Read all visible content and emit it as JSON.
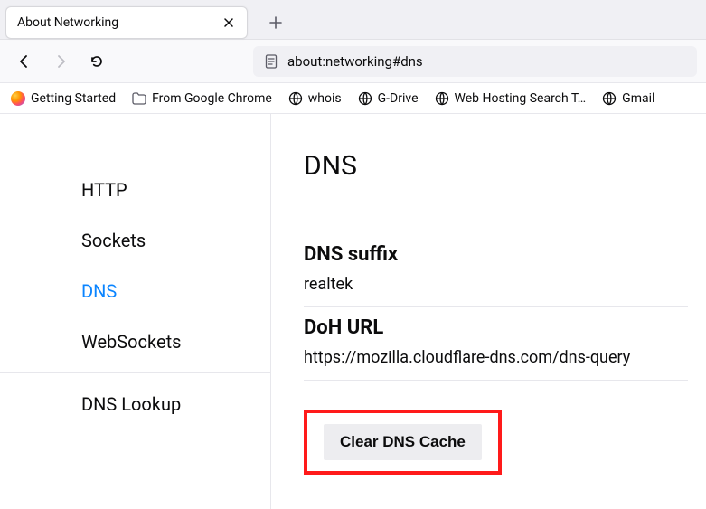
{
  "tab": {
    "title": "About Networking"
  },
  "urlbar": {
    "url": "about:networking#dns"
  },
  "bookmarks": [
    {
      "label": "Getting Started",
      "icon": "firefox"
    },
    {
      "label": "From Google Chrome",
      "icon": "folder"
    },
    {
      "label": "whois",
      "icon": "globe"
    },
    {
      "label": "G-Drive",
      "icon": "globe"
    },
    {
      "label": "Web Hosting Search T…",
      "icon": "globe"
    },
    {
      "label": "Gmail",
      "icon": "globe"
    }
  ],
  "sidebar": {
    "items": [
      {
        "label": "HTTP",
        "active": false
      },
      {
        "label": "Sockets",
        "active": false
      },
      {
        "label": "DNS",
        "active": true
      },
      {
        "label": "WebSockets",
        "active": false
      },
      {
        "label": "DNS Lookup",
        "active": false
      }
    ]
  },
  "page": {
    "title": "DNS",
    "dns_suffix_heading": "DNS suffix",
    "dns_suffix_value": "realtek",
    "doh_url_heading": "DoH URL",
    "doh_url_value": "https://mozilla.cloudflare-dns.com/dns-query",
    "clear_button": "Clear DNS Cache"
  }
}
